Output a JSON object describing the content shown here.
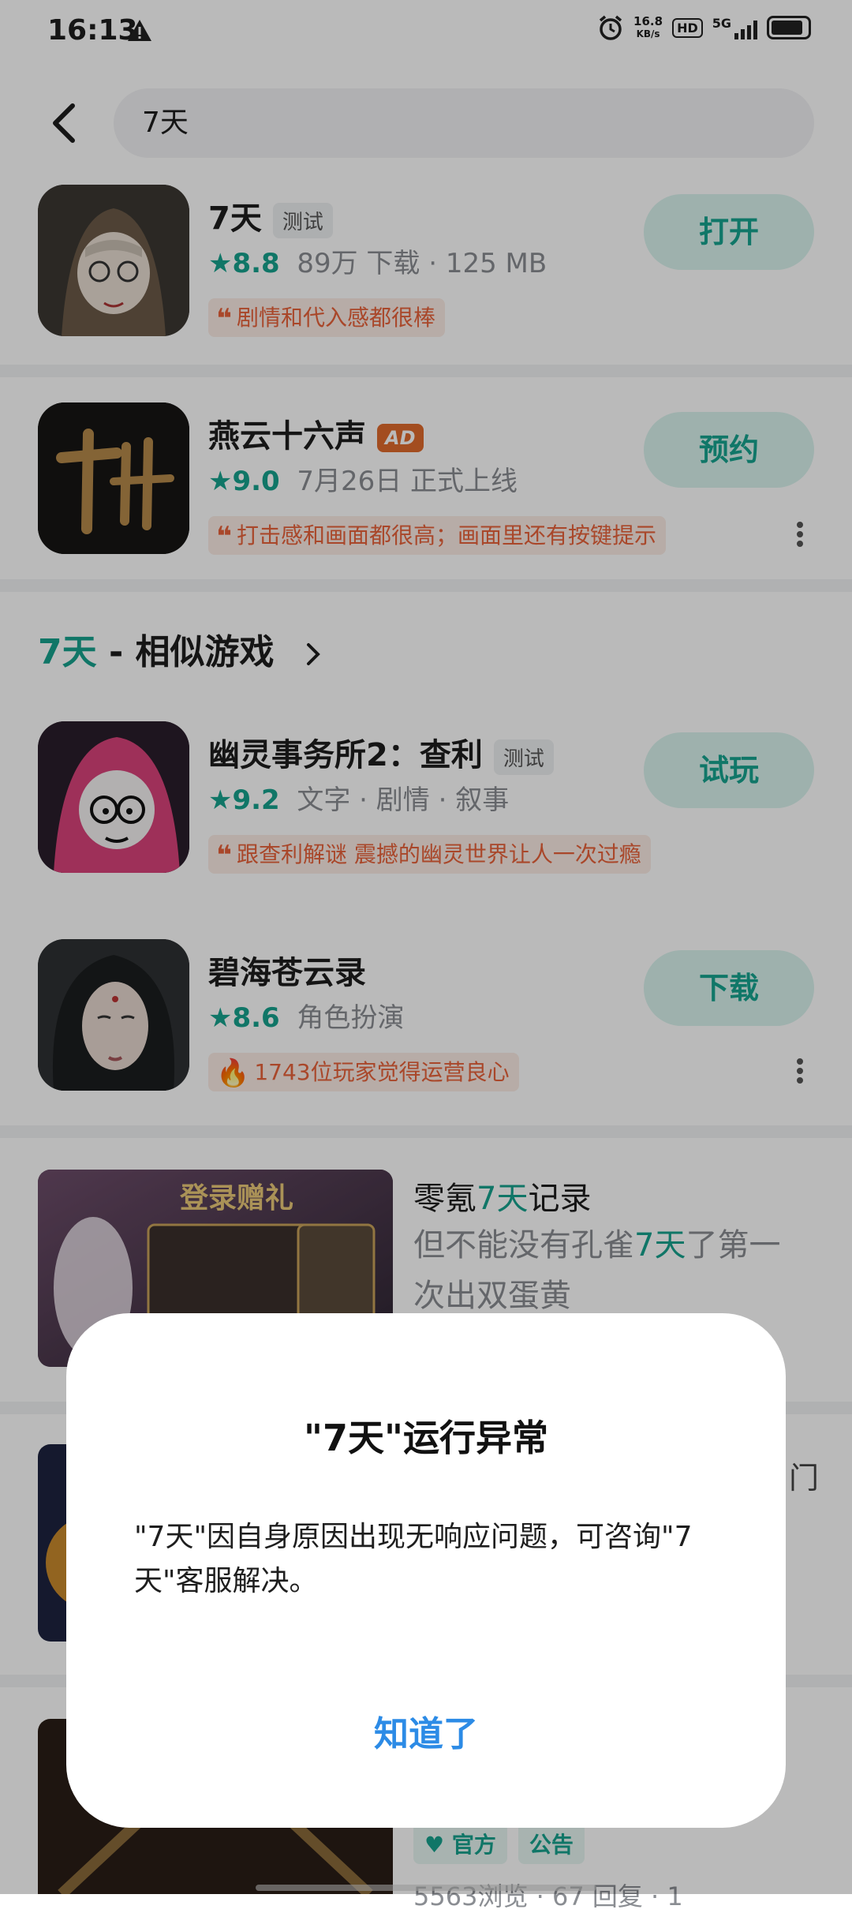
{
  "status_bar": {
    "time": "16:13",
    "net_speed_value": "16.8",
    "net_speed_unit": "KB/s",
    "hd": "HD",
    "network": "5G",
    "icons": [
      "warning-icon",
      "alarm-icon",
      "signal-icon",
      "battery-icon"
    ]
  },
  "search": {
    "query": "7天"
  },
  "results": [
    {
      "name": "7天",
      "tag": "测试",
      "rating": "8.8",
      "meta": "89万 下载 · 125 MB",
      "quote": "剧情和代入感都很棒",
      "action": "打开"
    },
    {
      "name": "燕云十六声",
      "tag": "AD",
      "rating": "9.0",
      "meta": "7月26日 正式上线",
      "quote": "打击感和画面都很高；画面里还有按键提示",
      "action": "预约"
    }
  ],
  "similar_section": {
    "highlight": "7天",
    "title": " - 相似游戏"
  },
  "similar_games": [
    {
      "name": "幽灵事务所2：查利",
      "tag": "测试",
      "rating": "9.2",
      "meta": "文字 · 剧情 · 叙事",
      "quote": "跟查利解谜 震撼的幽灵世界让人一次过瘾",
      "action": "试玩"
    },
    {
      "name": "碧海苍云录",
      "rating": "8.6",
      "meta": "角色扮演",
      "quote": "1743位玩家觉得运营良心",
      "action": "下载"
    }
  ],
  "articles": [
    {
      "title_pre": "零氪",
      "title_hl": "7天",
      "title_post": "记录",
      "sub_pre": "但不能没有孔雀",
      "sub_hl": "7天",
      "sub_post": "了第一次出双蛋黄"
    }
  ],
  "peek_bracket": "门",
  "article_chips": [
    "官方",
    "公告"
  ],
  "article_stats": "5563浏览 · 67 回复 · 1",
  "dialog": {
    "title": "\"7天\"运行异常",
    "message": "\"7天\"因自身原因出现无响应问题，可咨询\"7天\"客服解决。",
    "ok": "知道了"
  },
  "colors": {
    "accent": "#17a28e",
    "quote": "#e8623a",
    "ad_badge": "#e06a2c",
    "dialog_button": "#2c8be6"
  }
}
